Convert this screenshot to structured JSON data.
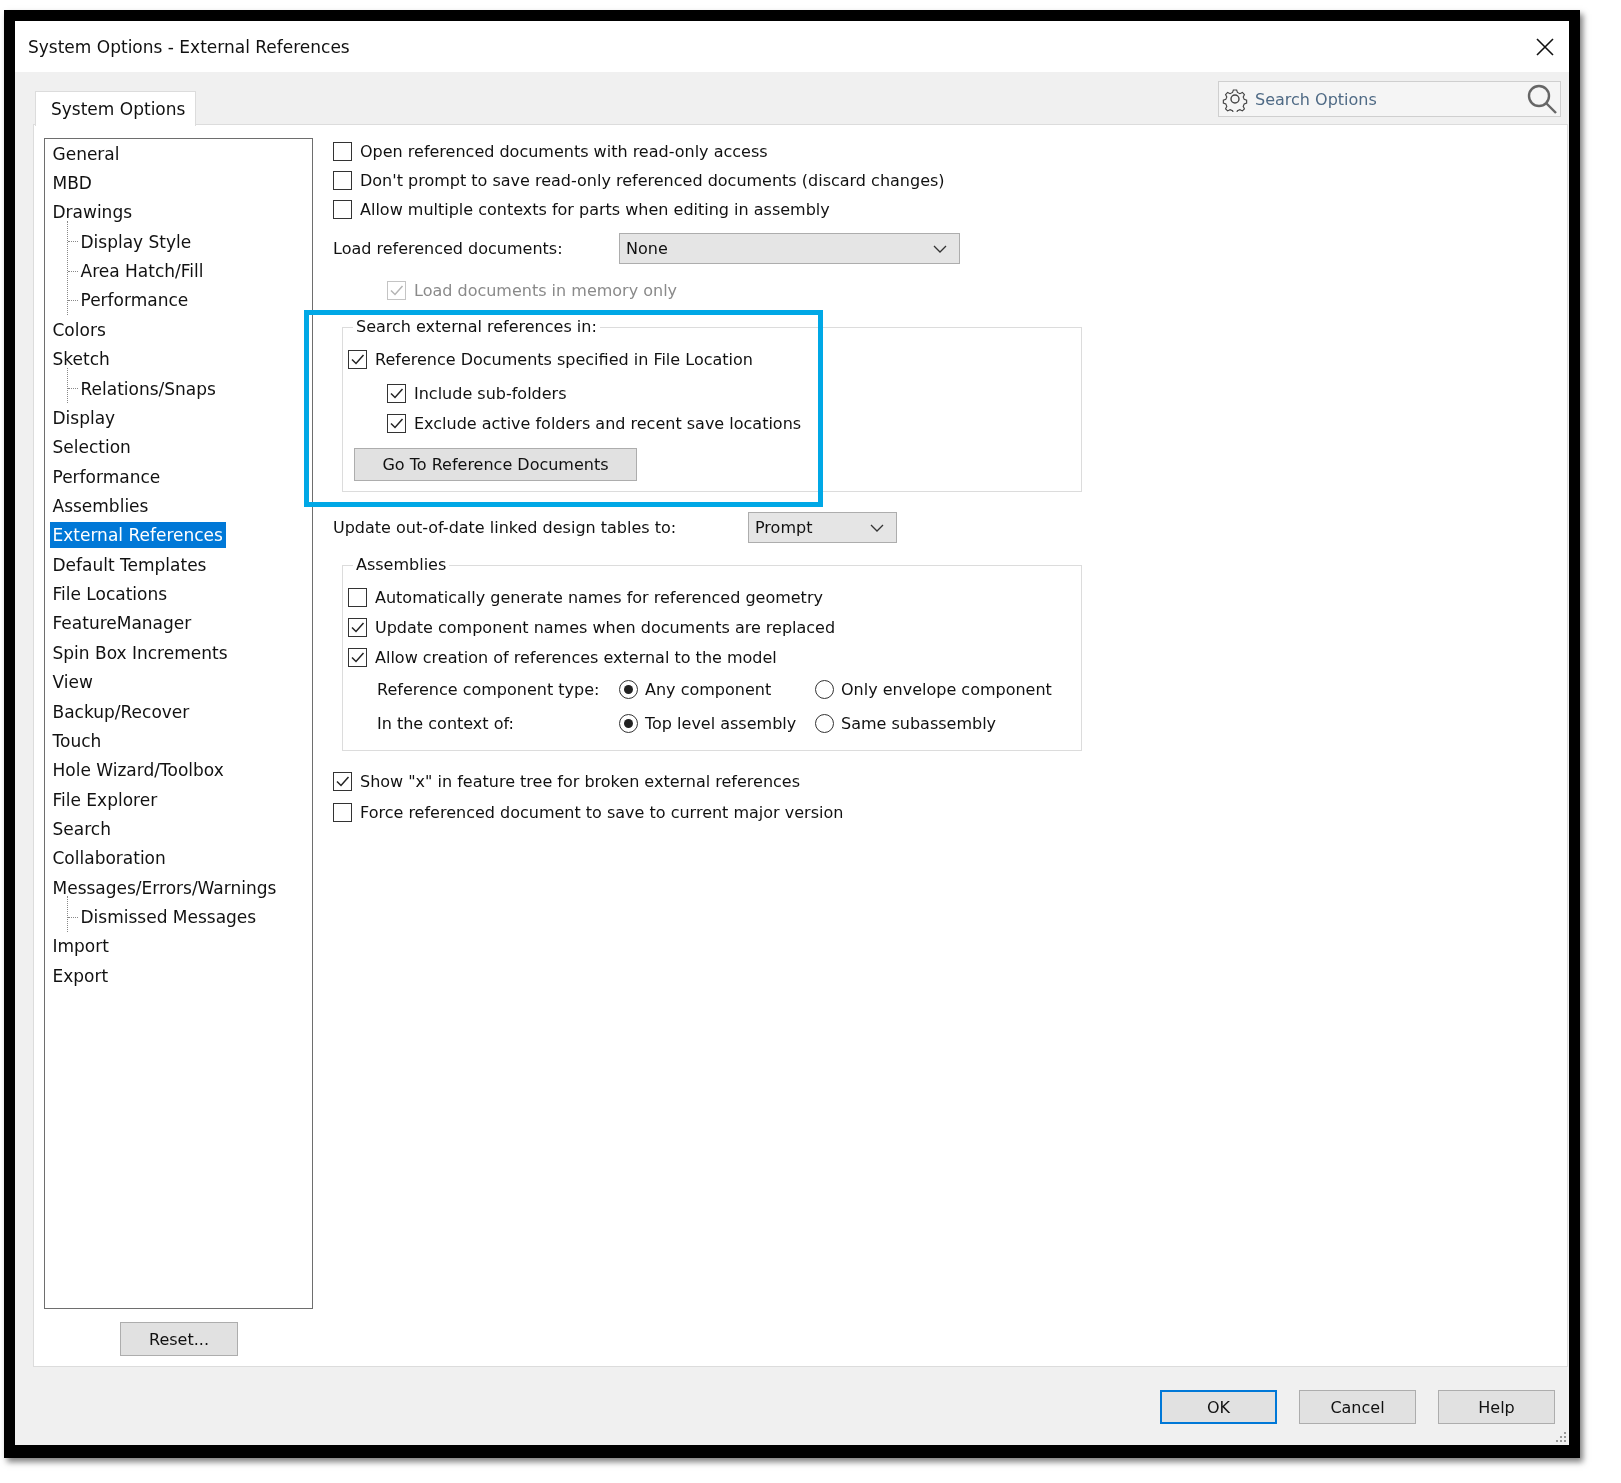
{
  "window": {
    "title": "System Options - External References"
  },
  "tabs": [
    {
      "label": "System Options",
      "selected": true
    }
  ],
  "search": {
    "placeholder": "Search Options"
  },
  "sidebar": {
    "items": [
      {
        "label": "General",
        "selected": false
      },
      {
        "label": "MBD",
        "selected": false
      },
      {
        "label": "Drawings",
        "selected": false,
        "children": [
          {
            "label": "Display Style",
            "selected": false
          },
          {
            "label": "Area Hatch/Fill",
            "selected": false
          },
          {
            "label": "Performance",
            "selected": false
          }
        ]
      },
      {
        "label": "Colors",
        "selected": false
      },
      {
        "label": "Sketch",
        "selected": false,
        "children": [
          {
            "label": "Relations/Snaps",
            "selected": false
          }
        ]
      },
      {
        "label": "Display",
        "selected": false
      },
      {
        "label": "Selection",
        "selected": false
      },
      {
        "label": "Performance",
        "selected": false
      },
      {
        "label": "Assemblies",
        "selected": false
      },
      {
        "label": "External References",
        "selected": true
      },
      {
        "label": "Default Templates",
        "selected": false
      },
      {
        "label": "File Locations",
        "selected": false
      },
      {
        "label": "FeatureManager",
        "selected": false
      },
      {
        "label": "Spin Box Increments",
        "selected": false
      },
      {
        "label": "View",
        "selected": false
      },
      {
        "label": "Backup/Recover",
        "selected": false
      },
      {
        "label": "Touch",
        "selected": false
      },
      {
        "label": "Hole Wizard/Toolbox",
        "selected": false
      },
      {
        "label": "File Explorer",
        "selected": false
      },
      {
        "label": "Search",
        "selected": false
      },
      {
        "label": "Collaboration",
        "selected": false
      },
      {
        "label": "Messages/Errors/Warnings",
        "selected": false,
        "children": [
          {
            "label": "Dismissed Messages",
            "selected": false
          }
        ]
      },
      {
        "label": "Import",
        "selected": false
      },
      {
        "label": "Export",
        "selected": false
      }
    ]
  },
  "reset_button": "Reset...",
  "options": [
    {
      "kind": "checkbox",
      "label": "Open referenced documents with read-only access",
      "checked": false,
      "disabled": false
    },
    {
      "kind": "checkbox",
      "label": "Don't prompt to save read-only referenced documents (discard changes)",
      "checked": false,
      "disabled": false
    },
    {
      "kind": "checkbox",
      "label": "Allow multiple contexts for parts when editing in assembly",
      "checked": false,
      "disabled": false
    },
    {
      "kind": "dropdown",
      "label": "Load referenced documents:",
      "value": "None"
    },
    {
      "kind": "subcheckbox",
      "label": "Load documents in memory only",
      "checked": true,
      "disabled": true
    },
    {
      "kind": "group",
      "title": "Search external references in:",
      "highlighted": true,
      "items": [
        {
          "kind": "checkbox",
          "label": "Reference Documents specified in File Location",
          "checked": true,
          "disabled": false,
          "children": [
            {
              "kind": "checkbox",
              "label": "Include sub-folders",
              "checked": true,
              "disabled": false
            },
            {
              "kind": "checkbox",
              "label": "Exclude active folders and recent save locations",
              "checked": true,
              "disabled": false
            }
          ]
        },
        {
          "kind": "button",
          "label": "Go To Reference Documents"
        }
      ]
    },
    {
      "kind": "dropdown",
      "label": "Update out-of-date linked design tables to:",
      "value": "Prompt"
    },
    {
      "kind": "group",
      "title": "Assemblies",
      "highlighted": false,
      "items": [
        {
          "kind": "checkbox",
          "label": "Automatically generate names for referenced geometry",
          "checked": false,
          "disabled": false
        },
        {
          "kind": "checkbox",
          "label": "Update component names when documents are replaced",
          "checked": true,
          "disabled": false
        },
        {
          "kind": "checkbox",
          "label": "Allow creation of references external to the model",
          "checked": true,
          "disabled": false
        },
        {
          "kind": "radio-row",
          "label": "Reference component type:",
          "options": [
            {
              "label": "Any component",
              "selected": true
            },
            {
              "label": "Only envelope component",
              "selected": false
            }
          ]
        },
        {
          "kind": "radio-row",
          "label": "In the context of:",
          "options": [
            {
              "label": "Top level assembly",
              "selected": true
            },
            {
              "label": "Same subassembly",
              "selected": false
            }
          ]
        }
      ]
    },
    {
      "kind": "checkbox",
      "label": "Show \"x\" in feature tree for broken external references",
      "checked": true,
      "disabled": false
    },
    {
      "kind": "checkbox",
      "label": "Force referenced document to save to current major version",
      "checked": false,
      "disabled": false
    }
  ],
  "buttons": [
    {
      "label": "OK",
      "default": true
    },
    {
      "label": "Cancel",
      "default": false
    },
    {
      "label": "Help",
      "default": false
    }
  ]
}
